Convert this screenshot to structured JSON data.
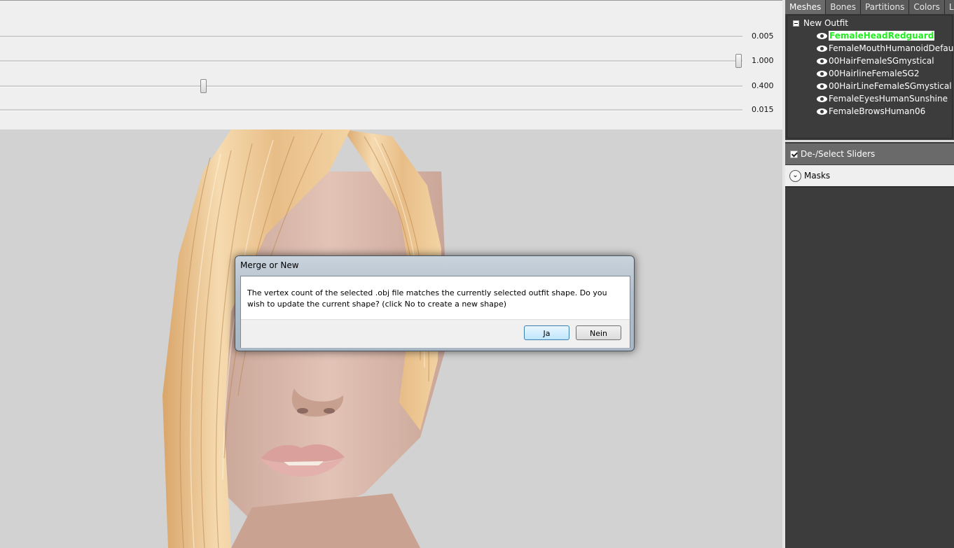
{
  "sliders": [
    {
      "value_label": "0.005",
      "thumb": false,
      "fraction": null
    },
    {
      "value_label": "1.000",
      "thumb": true,
      "fraction": 1.0
    },
    {
      "value_label": "0.400",
      "thumb": true,
      "fraction": 0.275
    },
    {
      "value_label": "0.015",
      "thumb": false,
      "fraction": null
    }
  ],
  "tabs": [
    "Meshes",
    "Bones",
    "Partitions",
    "Colors",
    "Ligh"
  ],
  "tree": {
    "root": "New Outfit",
    "items": [
      {
        "label": "FemaleHeadRedguard",
        "selected": true
      },
      {
        "label": "FemaleMouthHumanoidDefault",
        "selected": false
      },
      {
        "label": "00HairFemaleSGmystical",
        "selected": false
      },
      {
        "label": "00HairlineFemaleSG2",
        "selected": false
      },
      {
        "label": "00HairLineFemaleSGmystical",
        "selected": false
      },
      {
        "label": "FemaleEyesHumanSunshine",
        "selected": false
      },
      {
        "label": "FemaleBrowsHuman06",
        "selected": false
      }
    ]
  },
  "panel": {
    "deselect_label": "De-/Select Sliders",
    "masks_label": "Masks"
  },
  "dialog": {
    "title": "Merge or New",
    "message": "The vertex count of the selected .obj file matches the currently selected outfit shape.  Do you wish to update the current shape?  (click No to create a new shape)",
    "yes_label": "Ja",
    "no_label": "Nein"
  },
  "colors": {
    "selected_mesh": "#22ee22",
    "panel_bg": "#3c3c3c",
    "viewport_bg": "#d2d2d2"
  }
}
